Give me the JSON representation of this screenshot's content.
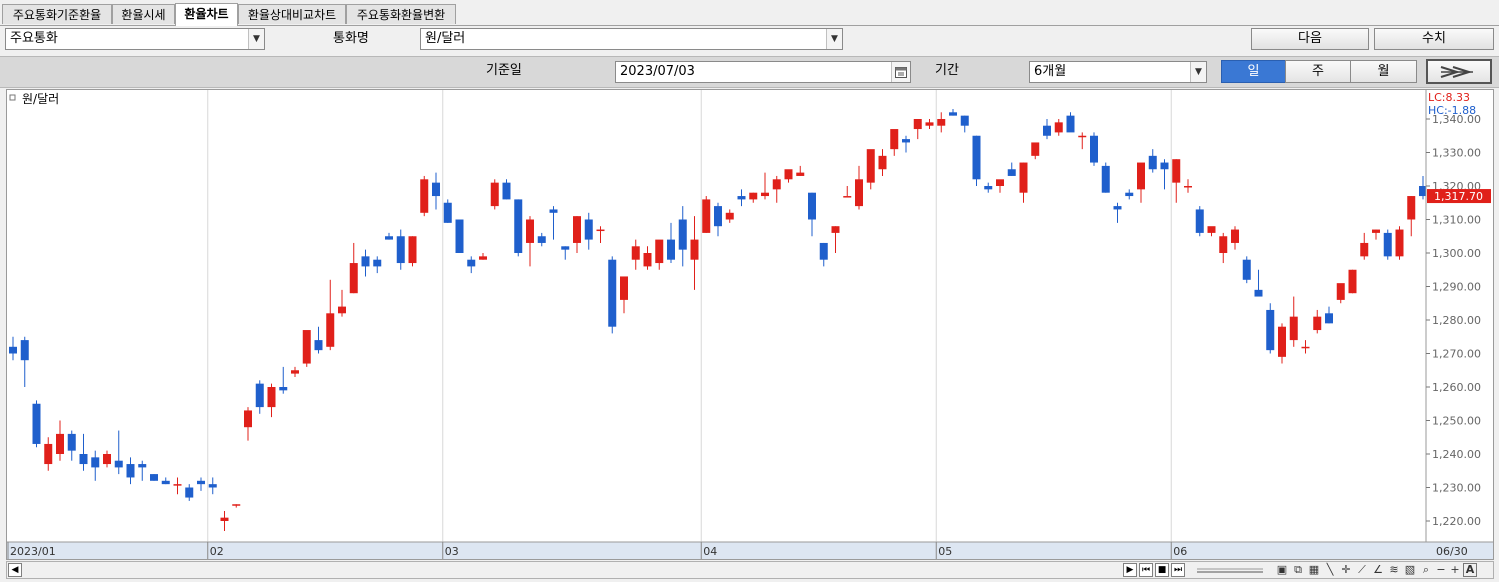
{
  "tabs": [
    {
      "label": "주요통화기준환율",
      "active": false
    },
    {
      "label": "환율시세",
      "active": false
    },
    {
      "label": "환율차트",
      "active": true
    },
    {
      "label": "환율상대비교차트",
      "active": false
    },
    {
      "label": "주요통화환율변환",
      "active": false
    }
  ],
  "toolbar": {
    "currency_group_value": "주요통화",
    "currency_name_label": "통화명",
    "currency_name_value": "원/달러",
    "next_button": "다음",
    "values_button": "수치",
    "base_date_label": "기준일",
    "base_date_value": "2023/07/03",
    "period_label": "기간",
    "period_value": "6개월",
    "day_button": "일",
    "week_button": "주",
    "month_button": "월",
    "active_interval": "일"
  },
  "chart_data": {
    "type": "candlestick",
    "legend": "원/달러",
    "lc_label": "LC:8.33",
    "hc_label": "HC:-1.88",
    "current_price": "1,317.70",
    "ylim": [
      1215,
      1345
    ],
    "y_ticks": [
      "1,220.00",
      "1,230.00",
      "1,240.00",
      "1,250.00",
      "1,260.00",
      "1,270.00",
      "1,280.00",
      "1,290.00",
      "1,300.00",
      "1,310.00",
      "1,320.00",
      "1,330.00",
      "1,340.00"
    ],
    "x_labels": [
      {
        "label": "2023/01",
        "index": 0
      },
      {
        "label": "02",
        "index": 17
      },
      {
        "label": "03",
        "index": 37
      },
      {
        "label": "04",
        "index": 59
      },
      {
        "label": "05",
        "index": 79
      },
      {
        "label": "06",
        "index": 99
      }
    ],
    "x_end_label": "06/30",
    "colors": {
      "up": "#e0201a",
      "down": "#1f5fcc",
      "grid": "#d8d8d8",
      "axis_bg": "#dde6f2"
    },
    "candles": [
      [
        1272,
        1275,
        1268,
        1270
      ],
      [
        1274,
        1275,
        1260,
        1268
      ],
      [
        1255,
        1256,
        1242,
        1243
      ],
      [
        1237,
        1245,
        1235,
        1243
      ],
      [
        1240,
        1250,
        1238,
        1246
      ],
      [
        1246,
        1247,
        1238,
        1241
      ],
      [
        1240,
        1246,
        1235,
        1237
      ],
      [
        1239,
        1241,
        1232,
        1236
      ],
      [
        1237,
        1241,
        1236,
        1240
      ],
      [
        1238,
        1247,
        1234,
        1236
      ],
      [
        1237,
        1239,
        1231,
        1233
      ],
      [
        1237,
        1238,
        1232,
        1236
      ],
      [
        1234,
        1234,
        1232,
        1232
      ],
      [
        1232,
        1233,
        1231,
        1231
      ],
      [
        1231,
        1233,
        1228,
        1231
      ],
      [
        1230,
        1231,
        1226,
        1227
      ],
      [
        1232,
        1233,
        1229,
        1231
      ],
      [
        1231,
        1233,
        1228,
        1230
      ],
      [
        1220,
        1223,
        1217,
        1221
      ],
      [
        1225,
        1225,
        1224,
        1225
      ],
      [
        1248,
        1254,
        1244,
        1253
      ],
      [
        1261,
        1262,
        1252,
        1254
      ],
      [
        1254,
        1261,
        1251,
        1260
      ],
      [
        1260,
        1266,
        1258,
        1259
      ],
      [
        1264,
        1266,
        1263,
        1265
      ],
      [
        1267,
        1276,
        1266,
        1277
      ],
      [
        1274,
        1278,
        1270,
        1271
      ],
      [
        1272,
        1292,
        1271,
        1282
      ],
      [
        1282,
        1289,
        1281,
        1284
      ],
      [
        1288,
        1303,
        1288,
        1297
      ],
      [
        1299,
        1301,
        1293,
        1296
      ],
      [
        1298,
        1299,
        1294,
        1296
      ],
      [
        1305,
        1306,
        1304,
        1304
      ],
      [
        1305,
        1307,
        1295,
        1297
      ],
      [
        1297,
        1305,
        1296,
        1305
      ],
      [
        1312,
        1323,
        1311,
        1322
      ],
      [
        1321,
        1324,
        1313,
        1317
      ],
      [
        1315,
        1316,
        1309,
        1309
      ],
      [
        1310,
        1310,
        1300,
        1300
      ],
      [
        1298,
        1299,
        1294,
        1296
      ],
      [
        1298,
        1300,
        1298,
        1299
      ],
      [
        1314,
        1322,
        1313,
        1321
      ],
      [
        1321,
        1322,
        1316,
        1316
      ],
      [
        1316,
        1316,
        1299,
        1300
      ],
      [
        1303,
        1311,
        1296,
        1310
      ],
      [
        1305,
        1306,
        1302,
        1303
      ],
      [
        1313,
        1314,
        1304,
        1312
      ],
      [
        1302,
        1302,
        1298,
        1301
      ],
      [
        1303,
        1311,
        1300,
        1311
      ],
      [
        1310,
        1312,
        1301,
        1304
      ],
      [
        1307,
        1308,
        1303,
        1307
      ],
      [
        1298,
        1299,
        1276,
        1278
      ],
      [
        1286,
        1293,
        1282,
        1293
      ],
      [
        1298,
        1304,
        1295,
        1302
      ],
      [
        1296,
        1302,
        1295,
        1300
      ],
      [
        1297,
        1303,
        1295,
        1304
      ],
      [
        1304,
        1309,
        1297,
        1298
      ],
      [
        1310,
        1314,
        1296,
        1301
      ],
      [
        1298,
        1311,
        1289,
        1304
      ],
      [
        1306,
        1317,
        1306,
        1316
      ],
      [
        1314,
        1315,
        1305,
        1308
      ],
      [
        1310,
        1313,
        1309,
        1312
      ],
      [
        1317,
        1319,
        1314,
        1316
      ],
      [
        1316,
        1318,
        1315,
        1318
      ],
      [
        1317,
        1324,
        1316,
        1318
      ],
      [
        1319,
        1323,
        1315,
        1322
      ],
      [
        1322,
        1323,
        1321,
        1325
      ],
      [
        1323,
        1326,
        1323,
        1324
      ],
      [
        1318,
        1318,
        1305,
        1310
      ],
      [
        1303,
        1303,
        1296,
        1298
      ],
      [
        1306,
        1308,
        1300,
        1308
      ],
      [
        1317,
        1320,
        1317,
        1317
      ],
      [
        1314,
        1326,
        1313,
        1322
      ],
      [
        1321,
        1327,
        1319,
        1331
      ],
      [
        1325,
        1331,
        1323,
        1329
      ],
      [
        1331,
        1335,
        1329,
        1337
      ],
      [
        1334,
        1335,
        1330,
        1333
      ],
      [
        1337,
        1338,
        1334,
        1340
      ],
      [
        1338,
        1340,
        1337,
        1339
      ],
      [
        1338,
        1342,
        1336,
        1340
      ],
      [
        1342,
        1343,
        1341,
        1341
      ],
      [
        1341,
        1341,
        1336,
        1338
      ],
      [
        1335,
        1335,
        1320,
        1322
      ],
      [
        1320,
        1321,
        1318,
        1319
      ],
      [
        1320,
        1321,
        1318,
        1322
      ],
      [
        1325,
        1327,
        1323,
        1323
      ],
      [
        1318,
        1327,
        1315,
        1327
      ],
      [
        1329,
        1332,
        1328,
        1333
      ],
      [
        1338,
        1340,
        1334,
        1335
      ],
      [
        1336,
        1340,
        1335,
        1339
      ],
      [
        1341,
        1342,
        1338,
        1336
      ],
      [
        1335,
        1336,
        1331,
        1335
      ],
      [
        1335,
        1336,
        1326,
        1327
      ],
      [
        1326,
        1327,
        1318,
        1318
      ],
      [
        1314,
        1315,
        1309,
        1313
      ],
      [
        1318,
        1319,
        1316,
        1317
      ],
      [
        1319,
        1323,
        1315,
        1327
      ],
      [
        1329,
        1331,
        1324,
        1325
      ],
      [
        1327,
        1328,
        1319,
        1325
      ],
      [
        1321,
        1328,
        1315,
        1328
      ],
      [
        1320,
        1322,
        1318,
        1320
      ],
      [
        1313,
        1314,
        1305,
        1306
      ],
      [
        1306,
        1307,
        1305,
        1308
      ],
      [
        1300,
        1306,
        1297,
        1305
      ],
      [
        1303,
        1308,
        1301,
        1307
      ],
      [
        1298,
        1299,
        1291,
        1292
      ],
      [
        1289,
        1295,
        1288,
        1287
      ],
      [
        1283,
        1285,
        1270,
        1271
      ],
      [
        1269,
        1279,
        1267,
        1278
      ],
      [
        1274,
        1287,
        1272,
        1281
      ],
      [
        1272,
        1274,
        1270,
        1272
      ],
      [
        1277,
        1283,
        1276,
        1281
      ],
      [
        1282,
        1284,
        1279,
        1279
      ],
      [
        1286,
        1287,
        1285,
        1291
      ],
      [
        1288,
        1295,
        1288,
        1295
      ],
      [
        1299,
        1306,
        1298,
        1303
      ],
      [
        1306,
        1307,
        1304,
        1307
      ],
      [
        1306,
        1307,
        1298,
        1299
      ],
      [
        1299,
        1308,
        1298,
        1307
      ],
      [
        1310,
        1317,
        1305,
        1317
      ],
      [
        1320,
        1323,
        1316,
        1317
      ]
    ]
  }
}
